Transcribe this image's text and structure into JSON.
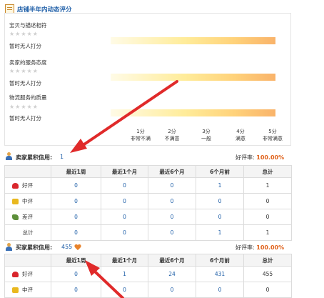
{
  "header": {
    "title": "店铺半年内动态评分"
  },
  "ratings": [
    {
      "label": "宝贝与描述相符",
      "stars": "★★★★★",
      "status": "暂时无人打分"
    },
    {
      "label": "卖家的服务态度",
      "stars": "★★★★★",
      "status": "暂时无人打分"
    },
    {
      "label": "物流服务的质量",
      "stars": "★★★★★",
      "status": "暂时无人打分"
    }
  ],
  "scale": [
    {
      "score": "1分",
      "desc": "非常不满"
    },
    {
      "score": "2分",
      "desc": "不满意"
    },
    {
      "score": "3分",
      "desc": "一般"
    },
    {
      "score": "4分",
      "desc": "满意"
    },
    {
      "score": "5分",
      "desc": "非常满意"
    }
  ],
  "seller": {
    "title": "卖家累积信用:",
    "value": "1",
    "rate_label": "好评率:",
    "rate_value": "100.00%",
    "columns": [
      "",
      "最近1周",
      "最近1个月",
      "最近6个月",
      "6个月前",
      "总计"
    ],
    "rows": [
      {
        "label": "好评",
        "cells": [
          "0",
          "0",
          "0",
          "1",
          "1"
        ]
      },
      {
        "label": "中评",
        "cells": [
          "0",
          "0",
          "0",
          "0",
          "0"
        ]
      },
      {
        "label": "差评",
        "cells": [
          "0",
          "0",
          "0",
          "0",
          "0"
        ]
      },
      {
        "label": "总计",
        "cells": [
          "0",
          "0",
          "0",
          "1",
          "1"
        ]
      }
    ]
  },
  "buyer": {
    "title": "买家累积信用:",
    "value": "455",
    "rate_label": "好评率:",
    "rate_value": "100.00%",
    "columns": [
      "",
      "最近1周",
      "最近1个月",
      "最近6个月",
      "6个月前",
      "总计"
    ],
    "rows": [
      {
        "label": "好评",
        "cells": [
          "0",
          "1",
          "24",
          "431",
          "455"
        ]
      },
      {
        "label": "中评",
        "cells": [
          "0",
          "0",
          "0",
          "0",
          "0"
        ]
      }
    ]
  },
  "colors": {
    "link": "#1f5fa8",
    "accent": "#e0611a",
    "arrow": "#e02a2a"
  }
}
